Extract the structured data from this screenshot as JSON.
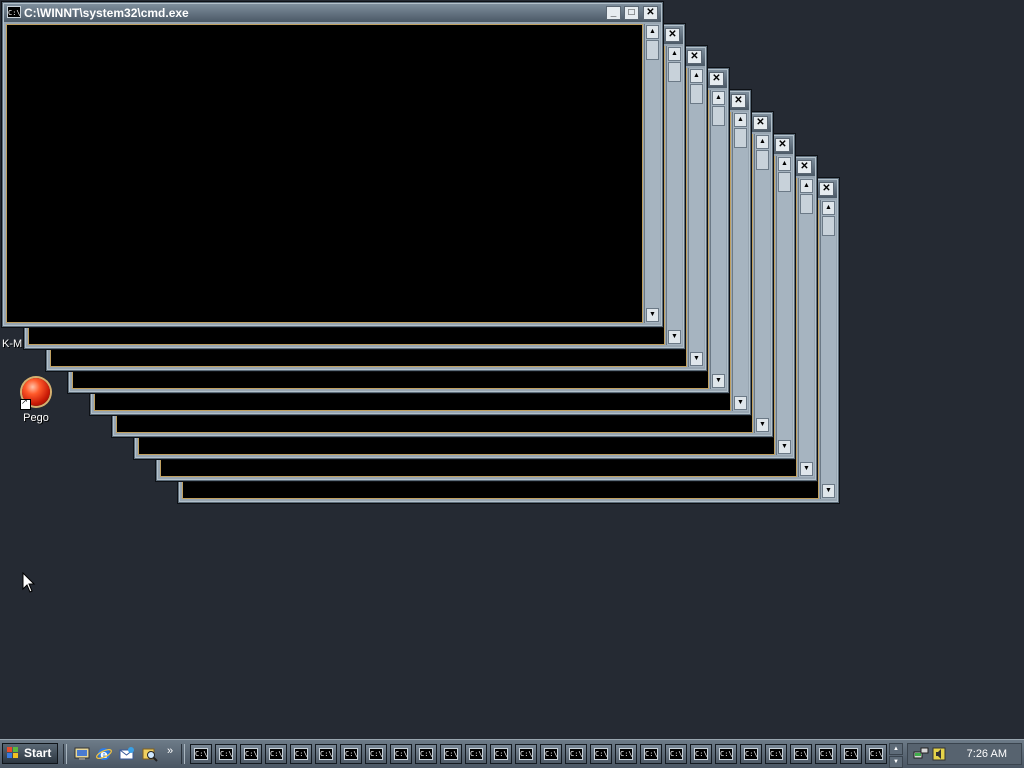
{
  "desktop": {
    "icons": [
      {
        "label": "K-M"
      },
      {
        "label": "Pego"
      }
    ]
  },
  "windows": {
    "active_title": "C:\\WINNT\\system32\\cmd.exe",
    "icon_glyph": "C:\\",
    "minimize_glyph": "_",
    "maximize_glyph": "□",
    "close_glyph": "✕",
    "scroll_up_glyph": "▲",
    "scroll_down_glyph": "▼"
  },
  "taskbar": {
    "start_label": "Start",
    "quicklaunch": [
      "desktop-icon",
      "internet-explorer-icon",
      "outlook-express-icon",
      "search-icon"
    ],
    "overflow_glyph": "»",
    "task_button_glyph": "C:\\",
    "tray_up_glyph": "▲",
    "tray_down_glyph": "▼",
    "clock": "7:26 AM"
  },
  "colors": {
    "desktop": "#252a33",
    "window_frame": "#98a6b2",
    "console_bg": "#000000",
    "console_border": "#c0a060",
    "taskbar": "#4a5663"
  }
}
